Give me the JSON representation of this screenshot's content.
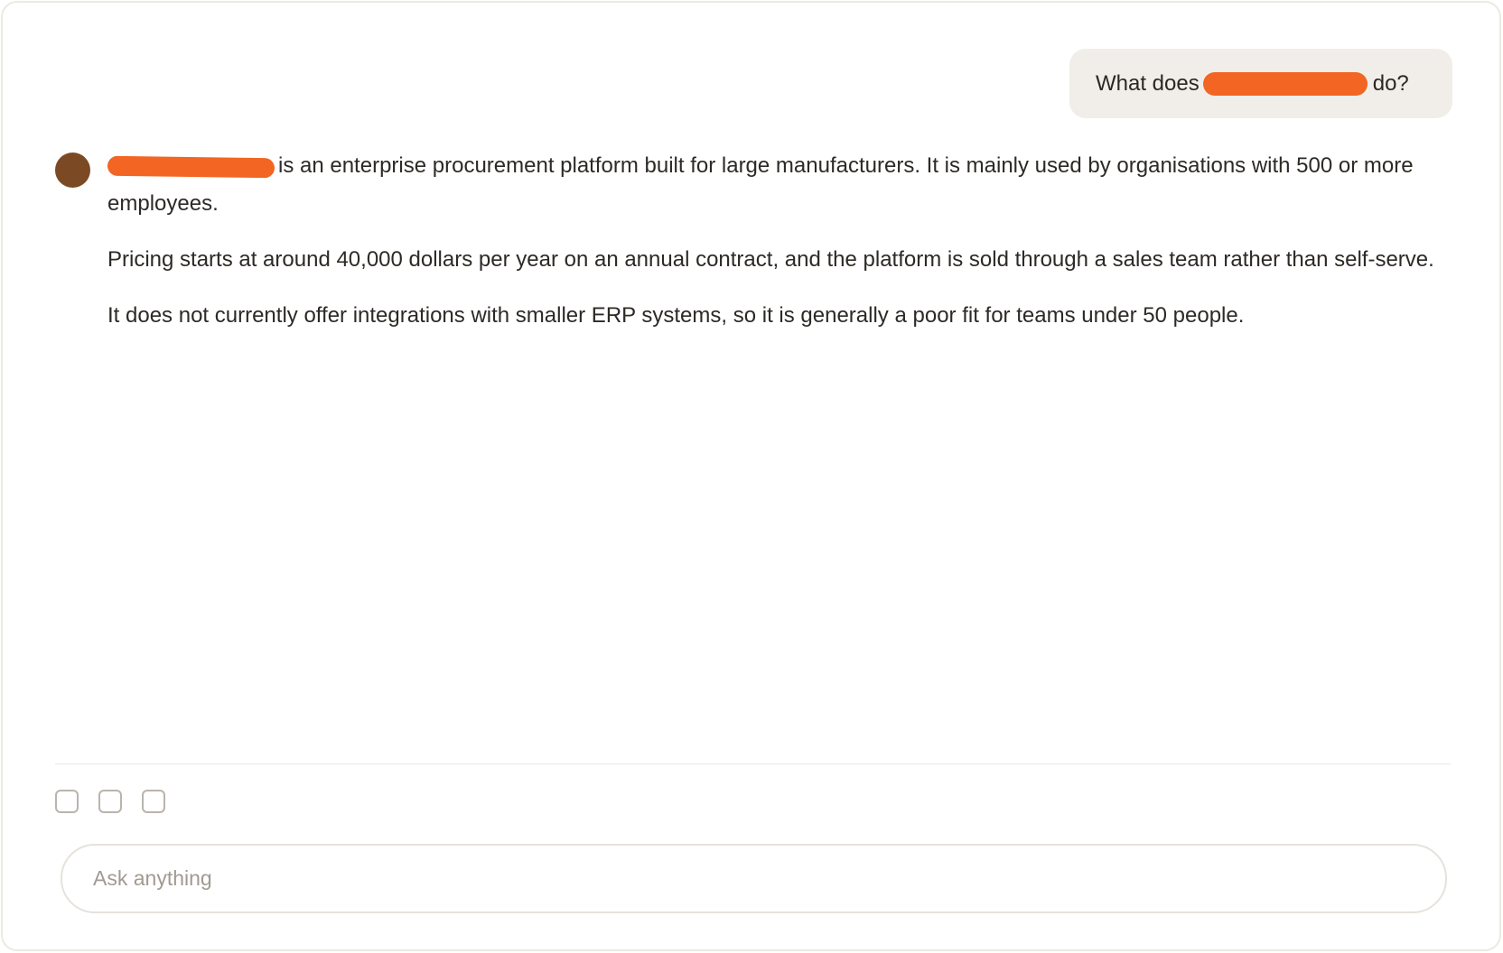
{
  "colors": {
    "accent_redaction": "#f26522",
    "avatar": "#7b4a25",
    "user_bubble": "#f1eee9"
  },
  "user_message": {
    "prefix": "What does",
    "suffix": "do?"
  },
  "assistant_message": {
    "paragraph_1_rest": "is an enterprise procurement platform built for large manufacturers. It is mainly used by organisations with 500 or more employees.",
    "paragraph_2": "Pricing starts at around 40,000 dollars per year on an annual contract, and the platform is sold through a sales team rather than self-serve.",
    "paragraph_3": "It does not currently offer integrations with smaller ERP systems, so it is generally a poor fit for teams under 50 people."
  },
  "toolbar": {
    "buttons": [
      "attachment-checkbox",
      "tool-checkbox",
      "option-checkbox"
    ]
  },
  "composer": {
    "placeholder": "Ask anything",
    "value": ""
  }
}
